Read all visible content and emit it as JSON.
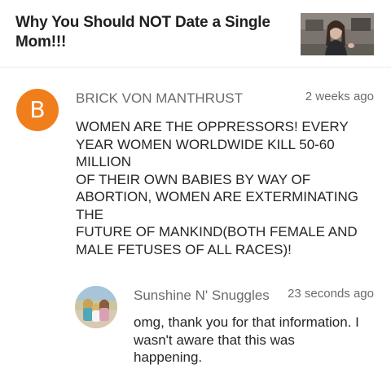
{
  "video": {
    "title": "Why You Should NOT Date a Single Mom!!!"
  },
  "comments": [
    {
      "avatar_letter": "B",
      "avatar_color": "#f07e1b",
      "author": "BRICK VON MANTHRUST",
      "time": "2 weeks ago",
      "lines": [
        "WOMEN ARE THE OPPRESSORS! EVERY",
        "YEAR WOMEN WORLDWIDE KILL 50-60",
        "MILLION",
        "OF THEIR OWN BABIES BY WAY OF",
        "ABORTION, WOMEN ARE EXTERMINATING",
        "THE",
        "FUTURE OF MANKIND(BOTH FEMALE AND",
        "MALE FETUSES OF ALL RACES)!"
      ]
    },
    {
      "author": "Sunshine N' Snuggles",
      "time": "23 seconds ago",
      "lines": [
        "omg, thank you for that information. I",
        "wasn't aware that this was",
        "happening."
      ]
    }
  ]
}
